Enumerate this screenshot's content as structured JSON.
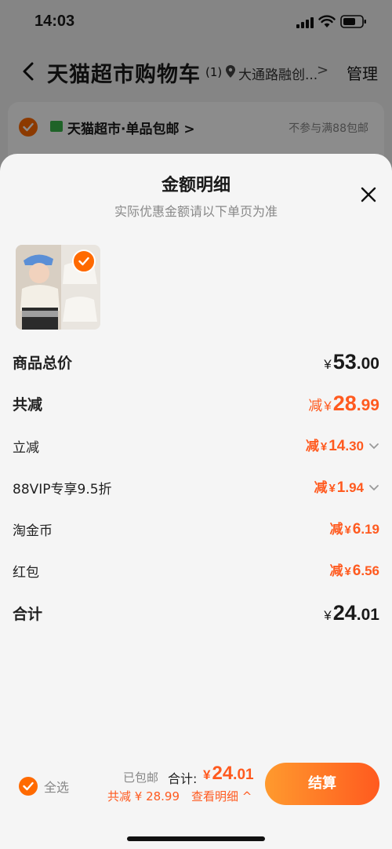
{
  "status_bar": {
    "time": "14:03"
  },
  "nav": {
    "title": "天猫超市购物车",
    "count": "(1)",
    "location": "大通路融创...",
    "location_arrow": ">",
    "manage": "管理"
  },
  "store": {
    "name": "天猫超市·单品包邮 >",
    "note": "不参与满88包邮"
  },
  "sheet": {
    "title": "金额明细",
    "subtitle": "实际优惠金额请以下单页为准",
    "rows": [
      {
        "label": "商品总价",
        "prefix": "",
        "yen": "¥",
        "int": "53",
        "dec": ".00"
      },
      {
        "label": "共减",
        "prefix": "减",
        "yen": "¥",
        "int": "28",
        "dec": ".99"
      },
      {
        "label": "立减",
        "prefix": "减",
        "yen": "¥",
        "int": "14",
        "dec": ".30"
      },
      {
        "label": "88VIP专享9.5折",
        "prefix": "减",
        "yen": "¥",
        "int": "1",
        "dec": ".94"
      },
      {
        "label": "淘金币",
        "prefix": "减",
        "yen": "¥",
        "int": "6",
        "dec": ".19"
      },
      {
        "label": "红包",
        "prefix": "减",
        "yen": "¥",
        "int": "6",
        "dec": ".56"
      },
      {
        "label": "合计",
        "prefix": "",
        "yen": "¥",
        "int": "24",
        "dec": ".01"
      }
    ]
  },
  "bottom_bar": {
    "select_all": "全选",
    "shipping": "已包邮",
    "total_label": "合计:",
    "total_yen": "¥",
    "total_int": "24",
    "total_dec": ".01",
    "savings": "共减 ¥ 28.99",
    "details_toggle": "查看明细 ^",
    "checkout": "结算"
  },
  "colors": {
    "accent": "#ff5a1f",
    "check": "#ff6a00",
    "badge": "#39b54a"
  }
}
